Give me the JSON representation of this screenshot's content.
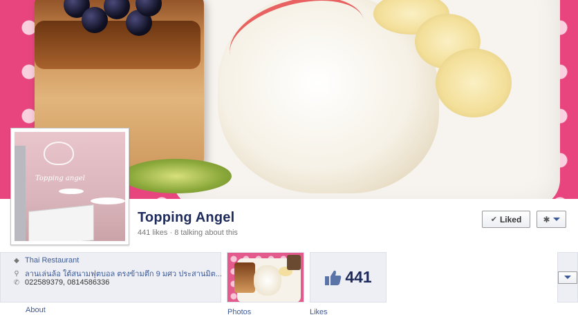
{
  "page": {
    "name": "Topping Angel",
    "stats": "441 likes · 8 talking about this"
  },
  "actions": {
    "liked_label": "Liked",
    "liked_icon": "checkmark-icon",
    "settings_icon": "gear-icon"
  },
  "info": {
    "category": "Thai Restaurant",
    "address": "ลานเล่นล้อ ใต้สนามฟุตบอล ตรงข้ามตึก 9 มศว ประสานมิต...",
    "phone": "022589379, 0814586336"
  },
  "profile_pic": {
    "logo_text": "Topping angel"
  },
  "tiles": {
    "likes_count": "441",
    "about_label": "About",
    "photos_label": "Photos",
    "likes_label": "Likes"
  },
  "colors": {
    "link": "#3b5998",
    "title": "#1d2a5b",
    "cover_pink": "#e8457f"
  }
}
